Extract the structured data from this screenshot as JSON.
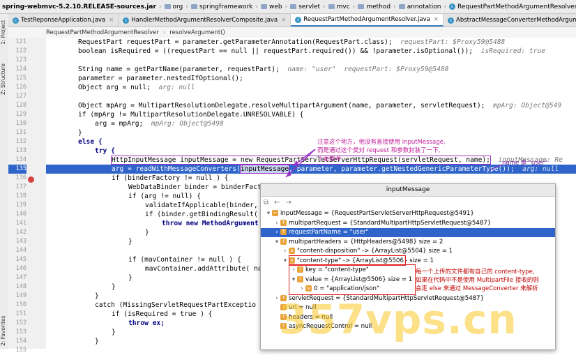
{
  "breadcrumb": [
    "spring-webmvc-5.2.10.RELEASE-sources.jar",
    "org",
    "springframework",
    "web",
    "servlet",
    "mvc",
    "method",
    "annotation",
    "RequestPartMethodArgumentResolver"
  ],
  "tabs": [
    {
      "label": "TestReponseApplication.java",
      "active": false
    },
    {
      "label": "HandlerMethodArgumentResolverComposite.java",
      "active": false
    },
    {
      "label": "RequestPartMethodArgumentResolver.java",
      "active": true
    },
    {
      "label": "AbstractMessageConverterMethodArgumentResolver.java",
      "active": false
    }
  ],
  "method_crumbs": [
    "RequestPartMethodArgumentResolver",
    "resolveArgument()"
  ],
  "side_labels": {
    "project": "1: Project",
    "structure": "Z: Structure",
    "favorites": "2: Favorites"
  },
  "line_numbers": [
    "121",
    "122",
    "123",
    "124",
    "125",
    "126",
    "127",
    "128",
    "129",
    "130",
    "131",
    "132",
    "133",
    "134",
    "135",
    "136",
    "137",
    "138",
    "139",
    "140",
    "141",
    "142",
    "143",
    "144",
    "145",
    "146",
    "147",
    "148",
    "149",
    "150",
    "151",
    "152",
    "153",
    "154",
    "155"
  ],
  "code": {
    "l121a": "RequestPart requestPart = parameter.getParameterAnnotation(RequestPart.class);",
    "l121h": "requestPart: $Proxy59@5488",
    "l122": "boolean isRequired = ((requestPart == null || requestPart.required()) && !parameter.isOptional());",
    "l122h": "isRequired: true",
    "l124": "String name = getPartName(parameter, requestPart);",
    "l124h": "name: \"user\"  requestPart: $Proxy59@5488",
    "l125": "parameter = parameter.nestedIfOptional();",
    "l126": "Object arg = null;",
    "l126h": "arg: null",
    "l128": "Object mpArg = MultipartResolutionDelegate.resolveMultipartArgument(name, parameter, servletRequest);",
    "l128h": "mpArg: Object@549",
    "l129": "if (mpArg != MultipartResolutionDelegate.UNRESOLVABLE) {",
    "l130": "arg = mpArg;",
    "l130h": "mpArg: Object@5498",
    "l131": "}",
    "l132": "else {",
    "l133": "try {",
    "l134": "HttpInputMessage inputMessage = new RequestPartServletServerHttpRequest(servletRequest, name);",
    "l134h": "inputMessage: Re",
    "l135a": "arg = readWithMessageConverters(",
    "l135b": "inputMessage",
    "l135c": ", parameter, parameter.getNestedGenericParameterType());",
    "l135h": "arg: null",
    "l136": "if (binderFactory != null ) {",
    "l137": "WebDataBinder binder = binderFact",
    "l138": "if (arg != null) {",
    "l139": "validateIfApplicable(binder,",
    "l140": "if (binder.getBindingResult(",
    "l141": "throw new MethodArgument",
    "l142": "}",
    "l143": "}",
    "l144": "if (mavContainer != null ) {",
    "l145": "mavContainer.addAttribute( na",
    "l146": "}",
    "l147": "}",
    "l148": "}",
    "l149": "catch (MissingServletRequestPartExceptio",
    "l150": "if (isRequired = true ) {",
    "l151": "throw ex;",
    "l152": "}",
    "l153": "}"
  },
  "annotations": {
    "note_main": [
      "注意这个地方，他没有直接使用 inputMessage,",
      "而是通过这个类对 request 和参数封装了一下,",
      "下面要考"
    ],
    "note_name": "name 是 \"user\"",
    "note_content_type": [
      "每一个上传的文件都有自己的 content-type,",
      "如果在代码中不是使用 MultipartFile 接收的则",
      "会走 else 来通过 MessageConverter 来解析"
    ]
  },
  "popup": {
    "title": "inputMessage",
    "nodes": [
      {
        "depth": 0,
        "arrow": "▾",
        "icon": "=",
        "text": "inputMessage = {RequestPartServletServerHttpRequest@5491}",
        "selected": false
      },
      {
        "depth": 1,
        "arrow": "›",
        "icon": "f",
        "text": "multipartRequest = {StandardMultipartHttpServletRequest@5487}",
        "selected": false
      },
      {
        "depth": 1,
        "arrow": "›",
        "icon": "f",
        "text": "requestPartName = \"user\"",
        "selected": true
      },
      {
        "depth": 1,
        "arrow": "▾",
        "icon": "f",
        "text": "multipartHeaders = {HttpHeaders@5498}  size = 2",
        "selected": false
      },
      {
        "depth": 2,
        "arrow": "›",
        "icon": "≡",
        "text": "\"content-disposition\" -> {ArrayList@5504}  size = 1",
        "selected": false
      },
      {
        "depth": 2,
        "arrow": "▾",
        "icon": "≡",
        "text": "\"content-type\" -> {ArrayList@5506}  size = 1",
        "selected": false
      },
      {
        "depth": 3,
        "arrow": "›",
        "icon": "f",
        "text": "key = \"content-type\"",
        "selected": false
      },
      {
        "depth": 3,
        "arrow": "▾",
        "icon": "f",
        "text": "value = {ArrayList@5506}  size = 1",
        "selected": false
      },
      {
        "depth": 4,
        "arrow": "›",
        "icon": "≡",
        "text": "0 = \"application/json\"",
        "selected": false
      },
      {
        "depth": 1,
        "arrow": "›",
        "icon": "f",
        "text": "servletRequest = {StandardMultipartHttpServletRequest@5487}",
        "selected": false
      },
      {
        "depth": 1,
        "arrow": "",
        "icon": "f",
        "text": "uri = null",
        "selected": false
      },
      {
        "depth": 1,
        "arrow": "",
        "icon": "f",
        "text": "headers = null",
        "selected": false
      },
      {
        "depth": 1,
        "arrow": "",
        "icon": "f",
        "text": "asyncRequestControl = null",
        "selected": false
      }
    ]
  },
  "watermark": "357vps.cn",
  "colors": {
    "selection": "#2f65ca",
    "annotation_purple": "#9b30c8",
    "annotation_red": "#c00000",
    "keyword": "#000080"
  }
}
